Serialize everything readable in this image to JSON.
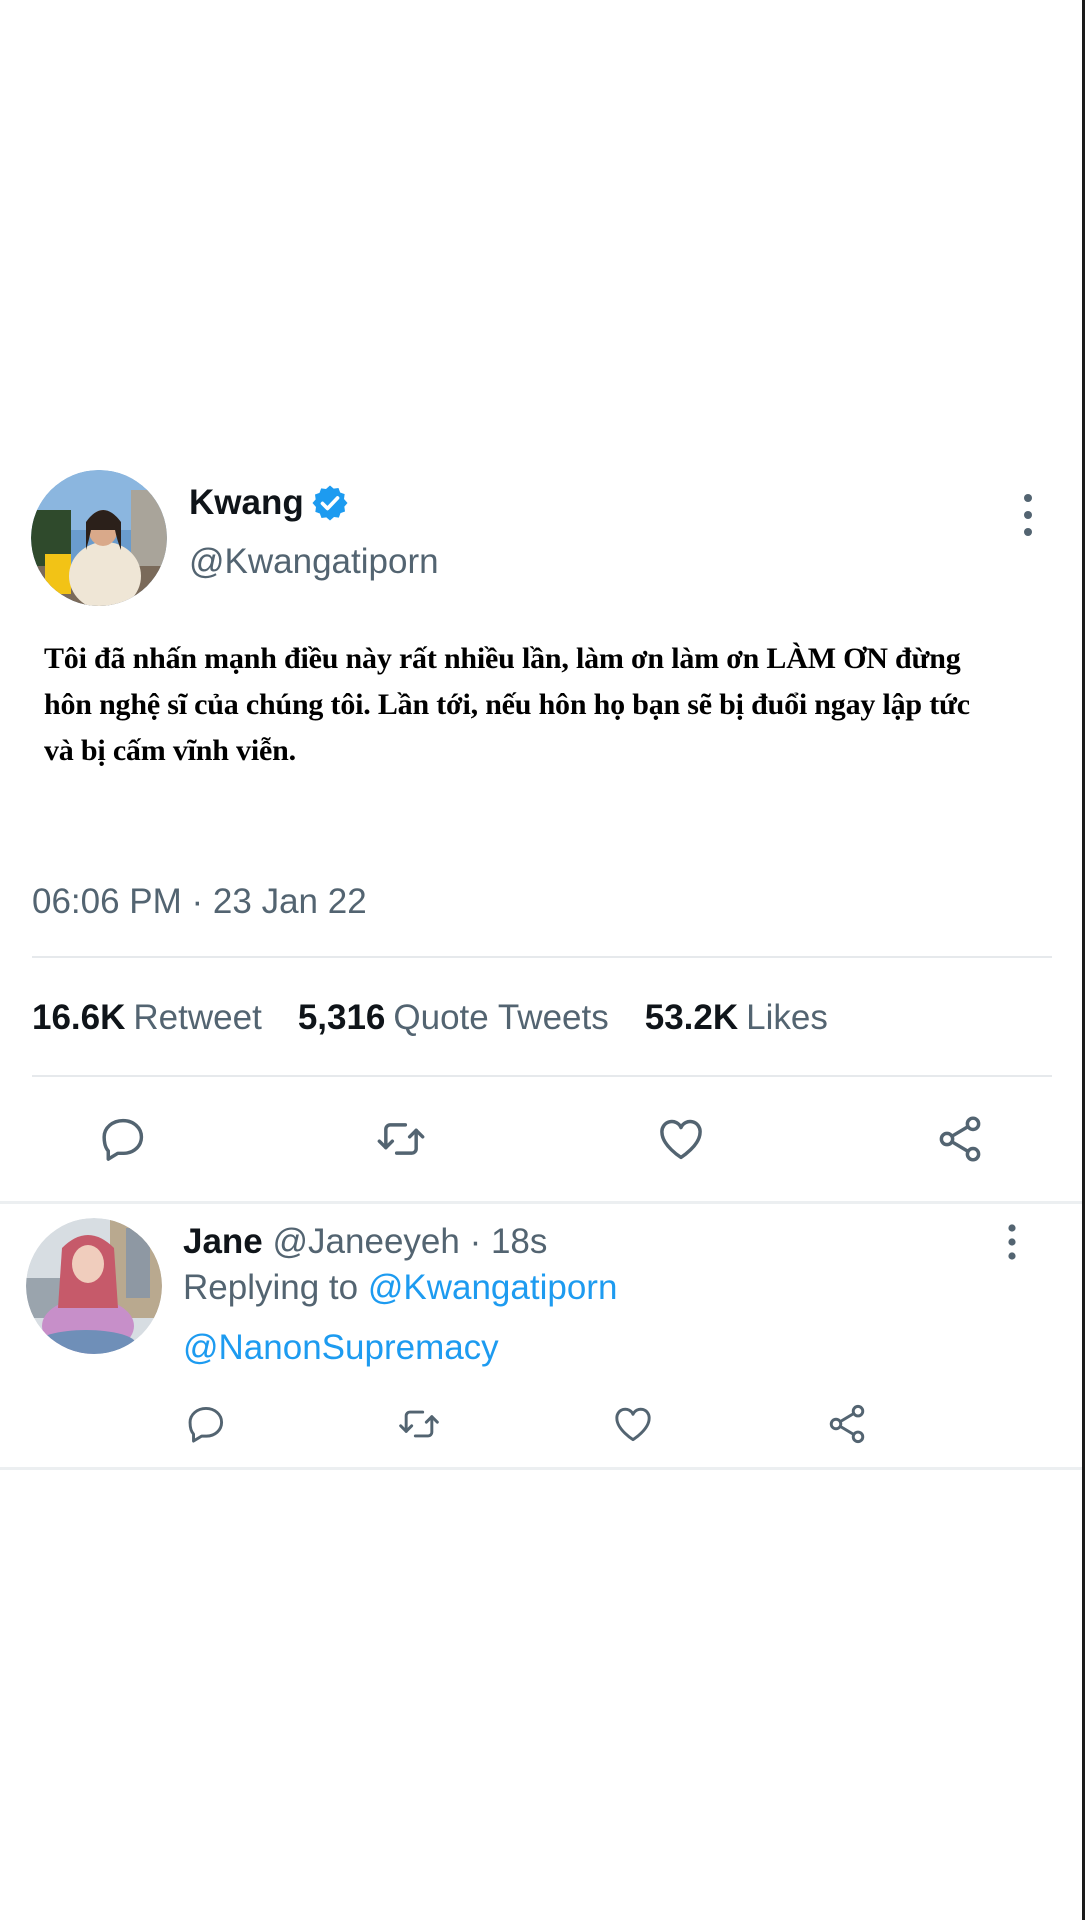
{
  "tweet": {
    "author": {
      "display_name": "Kwang",
      "handle": "@Kwangatiporn",
      "verified": true
    },
    "text_lines": [
      "Tôi đã nhấn mạnh điều này rất nhiều lần, làm ơn làm ơn LÀM ƠN đừng",
      "hôn nghệ sĩ của chúng tôi. Lần tới, nếu hôn họ bạn sẽ bị đuổi ngay lập tức",
      "và bị cấm vĩnh viễn."
    ],
    "timestamp": "06:06 PM · 23 Jan 22",
    "stats": {
      "retweets_count": "16.6K",
      "retweets_label": "Retweet",
      "quotes_count": "5,316",
      "quotes_label": "Quote Tweets",
      "likes_count": "53.2K",
      "likes_label": "Likes"
    },
    "actions": [
      "reply-icon",
      "retweet-icon",
      "like-icon",
      "share-icon"
    ]
  },
  "reply": {
    "display_name": "Jane",
    "handle": "@Janeeyeh",
    "separator": "·",
    "time": "18s",
    "replying_label": "Replying to",
    "replying_to": "@Kwangatiporn",
    "text": "@NanonSupremacy",
    "actions": [
      "reply-icon",
      "retweet-icon",
      "like-icon",
      "share-icon"
    ]
  },
  "colors": {
    "text_primary": "#0f1419",
    "text_secondary": "#536471",
    "link": "#1d9bf0",
    "verified": "#1d9bf0",
    "divider": "#e6e9ec"
  }
}
